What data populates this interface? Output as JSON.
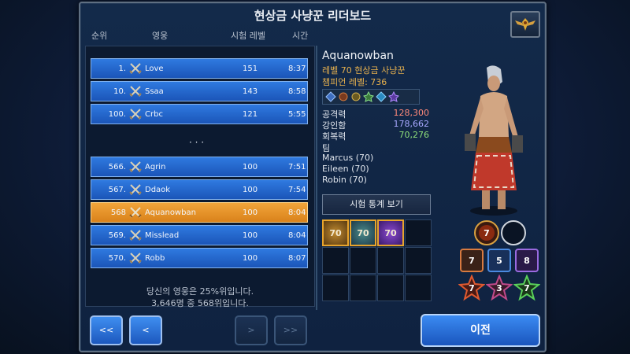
{
  "window": {
    "title": "현상금 사냥꾼 리더보드"
  },
  "columns": {
    "rank": "순위",
    "hero": "영웅",
    "trial_level": "시험 레벨",
    "time": "시간"
  },
  "leaderboard": {
    "top_rows": [
      {
        "rank": "1.",
        "name": "Love",
        "level": "151",
        "time": "8:37"
      },
      {
        "rank": "10.",
        "name": "Ssaa",
        "level": "143",
        "time": "8:58"
      },
      {
        "rank": "100.",
        "name": "Crbc",
        "level": "121",
        "time": "5:55"
      }
    ],
    "ellipsis": "· · ·",
    "near_rows": [
      {
        "rank": "566.",
        "name": "Agrin",
        "level": "100",
        "time": "7:51"
      },
      {
        "rank": "567.",
        "name": "Ddaok",
        "level": "100",
        "time": "7:54"
      },
      {
        "rank": "568",
        "name": "Aquanowban",
        "level": "100",
        "time": "8:04",
        "highlight": true
      },
      {
        "rank": "569.",
        "name": "Misslead",
        "level": "100",
        "time": "8:04"
      },
      {
        "rank": "570.",
        "name": "Robb",
        "level": "100",
        "time": "8:07"
      }
    ],
    "footer_line1": "당신의 영웅은 25%위입니다.",
    "footer_line2": "3,646명 중 568위입니다."
  },
  "hero": {
    "name": "Aquanowban",
    "level_class": "레벨 70 현상금 사냥꾼",
    "champion_level": "챔피언 레벨: 736",
    "stats": [
      {
        "label": "공격력",
        "value": "128,300",
        "color": "#ff8a7a"
      },
      {
        "label": "강인함",
        "value": "178,662",
        "color": "#a8a8ff"
      },
      {
        "label": "회복력",
        "value": "70,276",
        "color": "#8fe07a"
      }
    ],
    "team_label": "팀",
    "team": [
      "Marcus (70)",
      "Eileen (70)",
      "Robin (70)"
    ],
    "stats_button": "시험 통계 보기",
    "gems": [
      "70",
      "70",
      "70"
    ],
    "tokens": {
      "top": "7",
      "row1": [
        "7",
        "5",
        "8"
      ],
      "row2": [
        "7",
        "3",
        "7"
      ]
    }
  },
  "nav": {
    "first": "<<",
    "prev": "<",
    "next": ">",
    "last": ">>",
    "back": "이전"
  },
  "colors": {
    "row_blue": "#2f7ae0",
    "row_highlight": "#f2a53a",
    "accent_gold": "#e6b04e"
  }
}
